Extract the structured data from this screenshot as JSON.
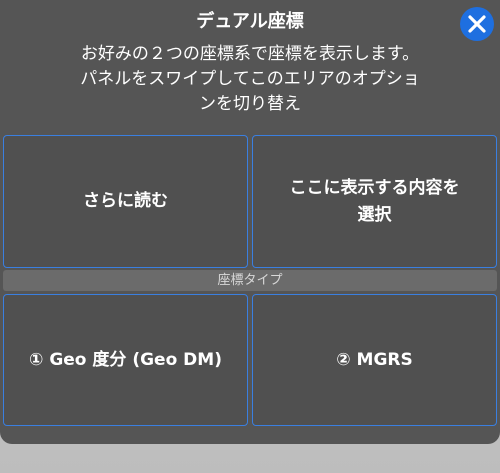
{
  "header": {
    "title": "デュアル座標"
  },
  "description": {
    "line1": "お好みの２つの座標系で座標を表示します。",
    "line2": "パネルをスワイプしてこのエリアのオプショ",
    "line3": "ンを切り替え"
  },
  "options": {
    "read_more": "さらに読む",
    "select_line1": "ここに表示する内容を",
    "select_line2": "選択"
  },
  "coordinate_types": {
    "label": "座標タイプ",
    "geo_dm": "① Geo 度分 (Geo DM)",
    "mgrs": "② MGRS"
  },
  "colors": {
    "accent": "#1e6fe0",
    "sheet_background": "#555555",
    "tile_border": "#3a7fe0"
  },
  "icons": {
    "close": "close-icon"
  }
}
